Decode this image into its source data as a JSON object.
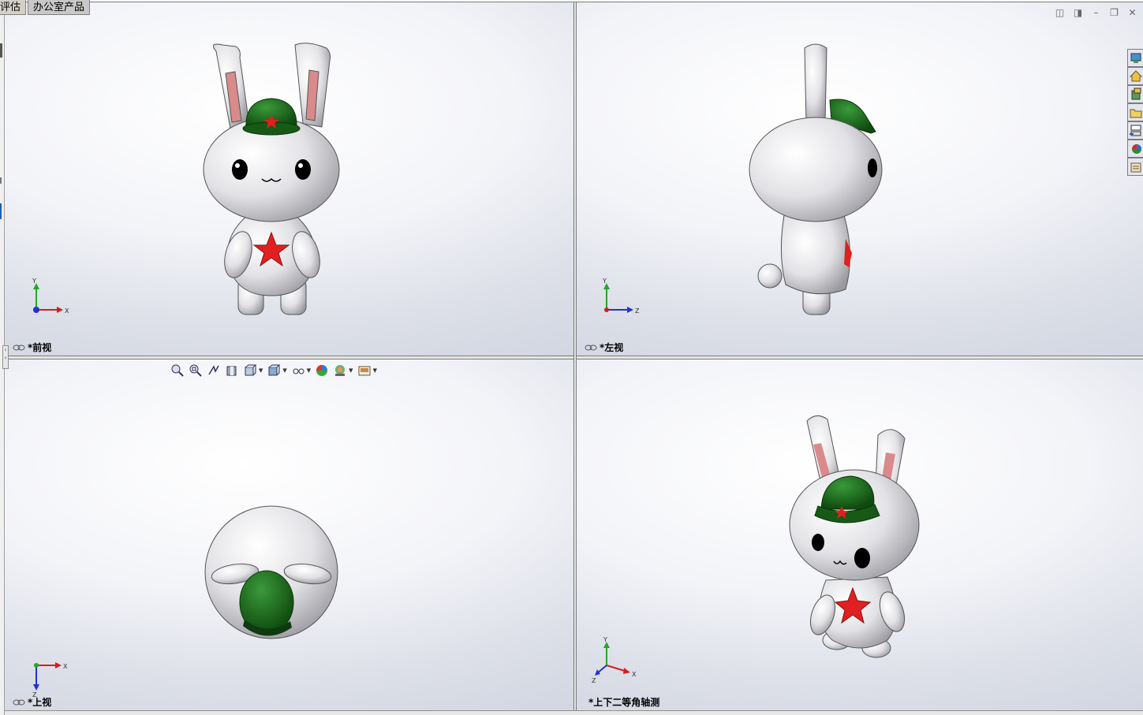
{
  "tabs": [
    {
      "label": "评估"
    },
    {
      "label": "办公室产品"
    }
  ],
  "viewports": {
    "front": {
      "label": "*前视",
      "axes": {
        "vertical": "Y",
        "horizontal": "X"
      }
    },
    "left": {
      "label": "*左视",
      "axes": {
        "vertical": "Y",
        "horizontal": "Z"
      }
    },
    "top": {
      "label": "*上视",
      "axes": {
        "vertical": "Z",
        "horizontal": "X"
      }
    },
    "iso": {
      "label": "*上下二等角轴测",
      "axes": {
        "vertical": "Y",
        "horizontal": "X",
        "depth": "Z"
      }
    }
  },
  "window_buttons": [
    {
      "icon": "tile-horizontal-icon",
      "glyph": "◫"
    },
    {
      "icon": "tile-vertical-icon",
      "glyph": "◨"
    },
    {
      "icon": "minimize-icon",
      "glyph": "–"
    },
    {
      "icon": "restore-icon",
      "glyph": "❐"
    },
    {
      "icon": "close-icon",
      "glyph": "✕"
    }
  ],
  "task_pane": [
    "resources-icon",
    "home-icon",
    "design-library-icon",
    "file-explorer-icon",
    "view-palette-icon",
    "appearances-icon",
    "custom-properties-icon"
  ],
  "view_toolbar": [
    "zoom-to-fit-icon",
    "zoom-to-area-icon",
    "previous-view-icon",
    "section-view-icon",
    "view-orientation-icon",
    "display-style-icon",
    "hide-show-items-icon",
    "edit-appearance-icon",
    "apply-scene-icon",
    "view-settings-icon"
  ],
  "colors": {
    "hat": "#1f6b1f",
    "star": "#e02020",
    "ear_inner": "#d98a8a",
    "body": "#ececf0",
    "axis_x": "#cc2222",
    "axis_y": "#22aa22",
    "axis_z": "#2233cc"
  }
}
